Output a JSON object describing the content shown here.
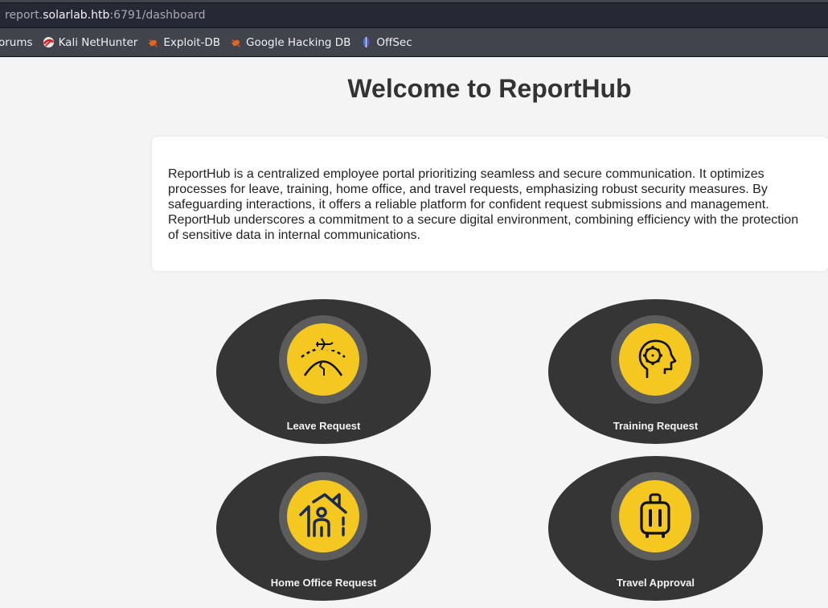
{
  "browser": {
    "url_prefix": "report.",
    "url_host": "solarlab.htb",
    "url_suffix": ":6791/dashboard",
    "bookmarks": [
      {
        "label": "orums",
        "icon": "forum-icon"
      },
      {
        "label": "Kali NetHunter",
        "icon": "kali-nethunter-icon"
      },
      {
        "label": "Exploit-DB",
        "icon": "exploit-db-icon"
      },
      {
        "label": "Google Hacking DB",
        "icon": "ghdb-icon"
      },
      {
        "label": "OffSec",
        "icon": "offsec-icon"
      }
    ]
  },
  "page": {
    "title": "Welcome to ReportHub",
    "intro": "ReportHub is a centralized employee portal prioritizing seamless and secure communication. It optimizes processes for leave, training, home office, and travel requests, emphasizing robust security measures. By safeguarding interactions, it offers a reliable platform for confident request submissions and management. ReportHub underscores a commitment to a secure digital environment, combining efficiency with the protection of sensitive data in internal communications.",
    "cards": [
      {
        "label": "Leave Request",
        "icon": "airplane-globe-icon"
      },
      {
        "label": "Training Request",
        "icon": "head-gear-icon"
      },
      {
        "label": "Home Office Request",
        "icon": "home-person-icon"
      },
      {
        "label": "Travel Approval",
        "icon": "luggage-icon"
      }
    ]
  },
  "colors": {
    "accent": "#f4c821",
    "card_bg": "#353535",
    "ring": "#5c5c5c"
  }
}
